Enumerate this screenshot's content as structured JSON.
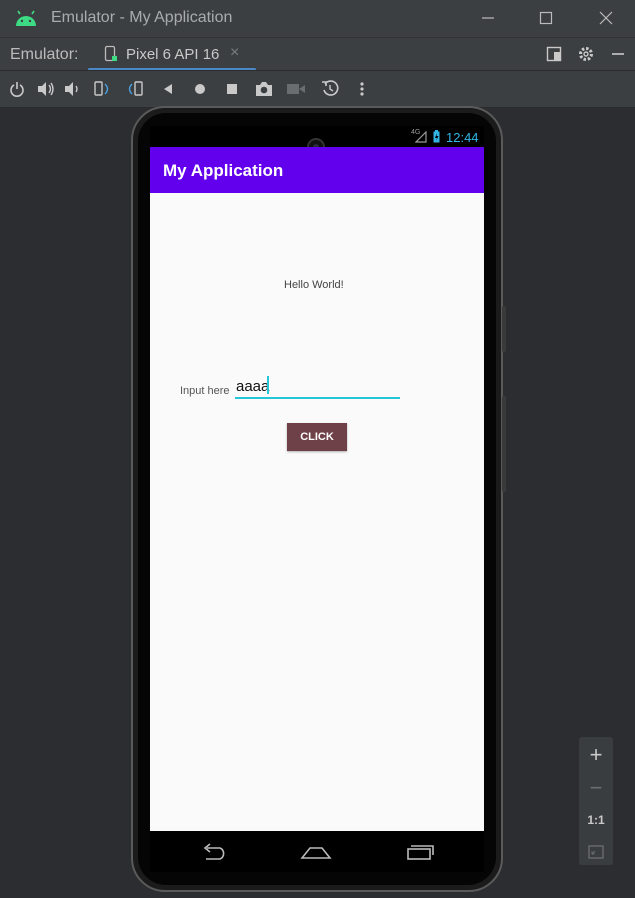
{
  "window": {
    "title": "Emulator - My Application",
    "controls": [
      "minimize",
      "maximize",
      "close"
    ]
  },
  "tabbar": {
    "emulator_label": "Emulator:",
    "tab_label": "Pixel 6 API 16",
    "close_symbol": "×"
  },
  "toolbar": {
    "icons": [
      "power-icon",
      "volume-up-icon",
      "volume-down-icon",
      "rotate-left-icon",
      "rotate-right-icon",
      "back-icon",
      "home-icon",
      "overview-icon",
      "camera-icon",
      "video-icon",
      "snapshot-icon",
      "more-icon"
    ]
  },
  "device": {
    "status": {
      "network": "4G",
      "time": "12:44"
    },
    "app_title": "My Application",
    "hello_text": "Hello World!",
    "input_label": "Input here",
    "input_value": "aaaa",
    "button_label": "CLICK"
  },
  "zoom": {
    "plus": "+",
    "minus": "−",
    "one_to_one": "1:1"
  },
  "colors": {
    "accent_purple": "#6200ee",
    "button_brown": "#6d4147",
    "field_underline": "#26c6da",
    "clock_blue": "#33b5e5"
  }
}
